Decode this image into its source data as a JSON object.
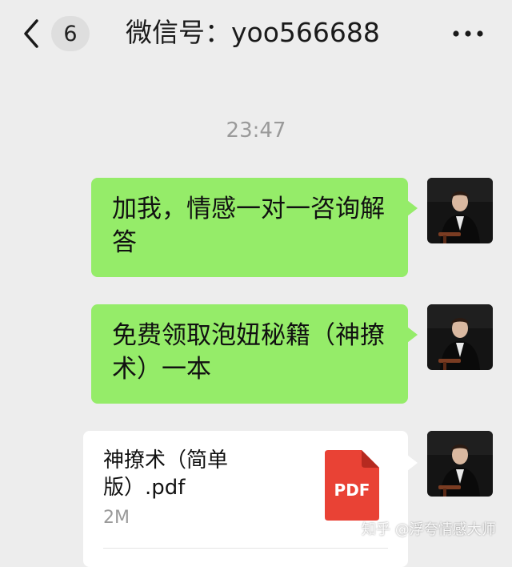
{
  "header": {
    "unread_count": "6",
    "title": "微信号：yoo566688"
  },
  "chat": {
    "timestamp": "23:47",
    "messages": [
      {
        "type": "text",
        "text": "加我，情感一对一咨询解答"
      },
      {
        "type": "text",
        "text": "免费领取泡妞秘籍（神撩术）一本"
      },
      {
        "type": "file",
        "file_name": "神撩术（简单版）.pdf",
        "file_size": "2M",
        "file_badge": "PDF"
      }
    ]
  },
  "watermark": "知乎 @浮夸情感大师",
  "colors": {
    "background": "#ededed",
    "bubble": "#95ec69",
    "pdf_icon": "#e94235"
  },
  "icons": [
    "back-arrow-icon",
    "more-icon",
    "pdf-file-icon"
  ]
}
